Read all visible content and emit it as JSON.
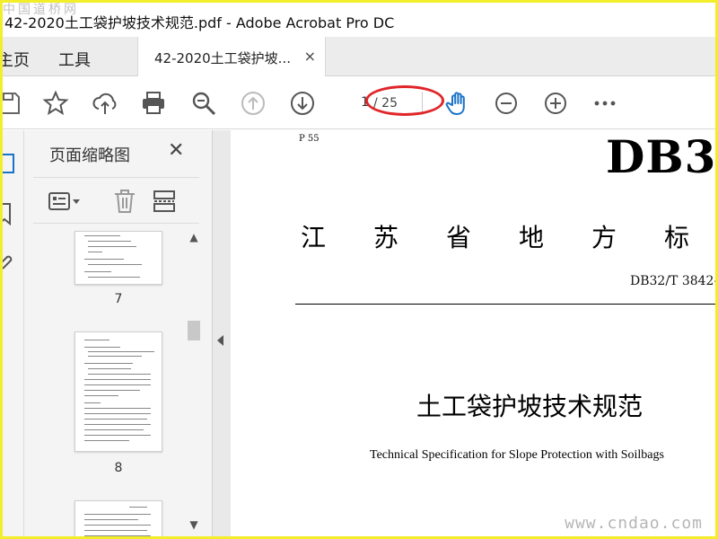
{
  "watermark": {
    "top": "中国道桥网",
    "bottom": "www.cndao.com"
  },
  "window": {
    "title": "42-2020土工袋护坡技术规范.pdf - Adobe Acrobat Pro DC"
  },
  "tabs": {
    "home": "主页",
    "tools": "工具",
    "document": "42-2020土工袋护坡...",
    "close_icon": "×"
  },
  "toolbar": {
    "page_current": "1",
    "page_total": "/ 25",
    "icons": [
      "save-icon",
      "star-icon",
      "cloud-upload-icon",
      "print-icon",
      "zoom-search-icon",
      "page-up-icon",
      "page-down-icon",
      "hand-tool-icon",
      "zoom-out-icon",
      "zoom-in-icon",
      "more-icon"
    ],
    "accent_color": "#1a73c8",
    "annotation_color": "#e0262a"
  },
  "left_rail": {
    "icons": [
      "page-thumbnails-icon",
      "bookmark-icon",
      "attachment-icon"
    ]
  },
  "thumbnail_panel": {
    "title": "页面缩略图",
    "close": "✕",
    "tools": [
      "options-menu-icon",
      "delete-icon",
      "extract-icon"
    ],
    "thumbnails": [
      {
        "label": "7"
      },
      {
        "label": "8"
      }
    ]
  },
  "document": {
    "page_marker": "P 55",
    "header_code": "DB3",
    "province_chars": [
      "江",
      "苏",
      "省",
      "地",
      "方",
      "标"
    ],
    "standard_number": "DB32/T  3842—",
    "title_cn": "土工袋护坡技术规范",
    "title_en": "Technical Specification for Slope Protection with Soilbags"
  }
}
